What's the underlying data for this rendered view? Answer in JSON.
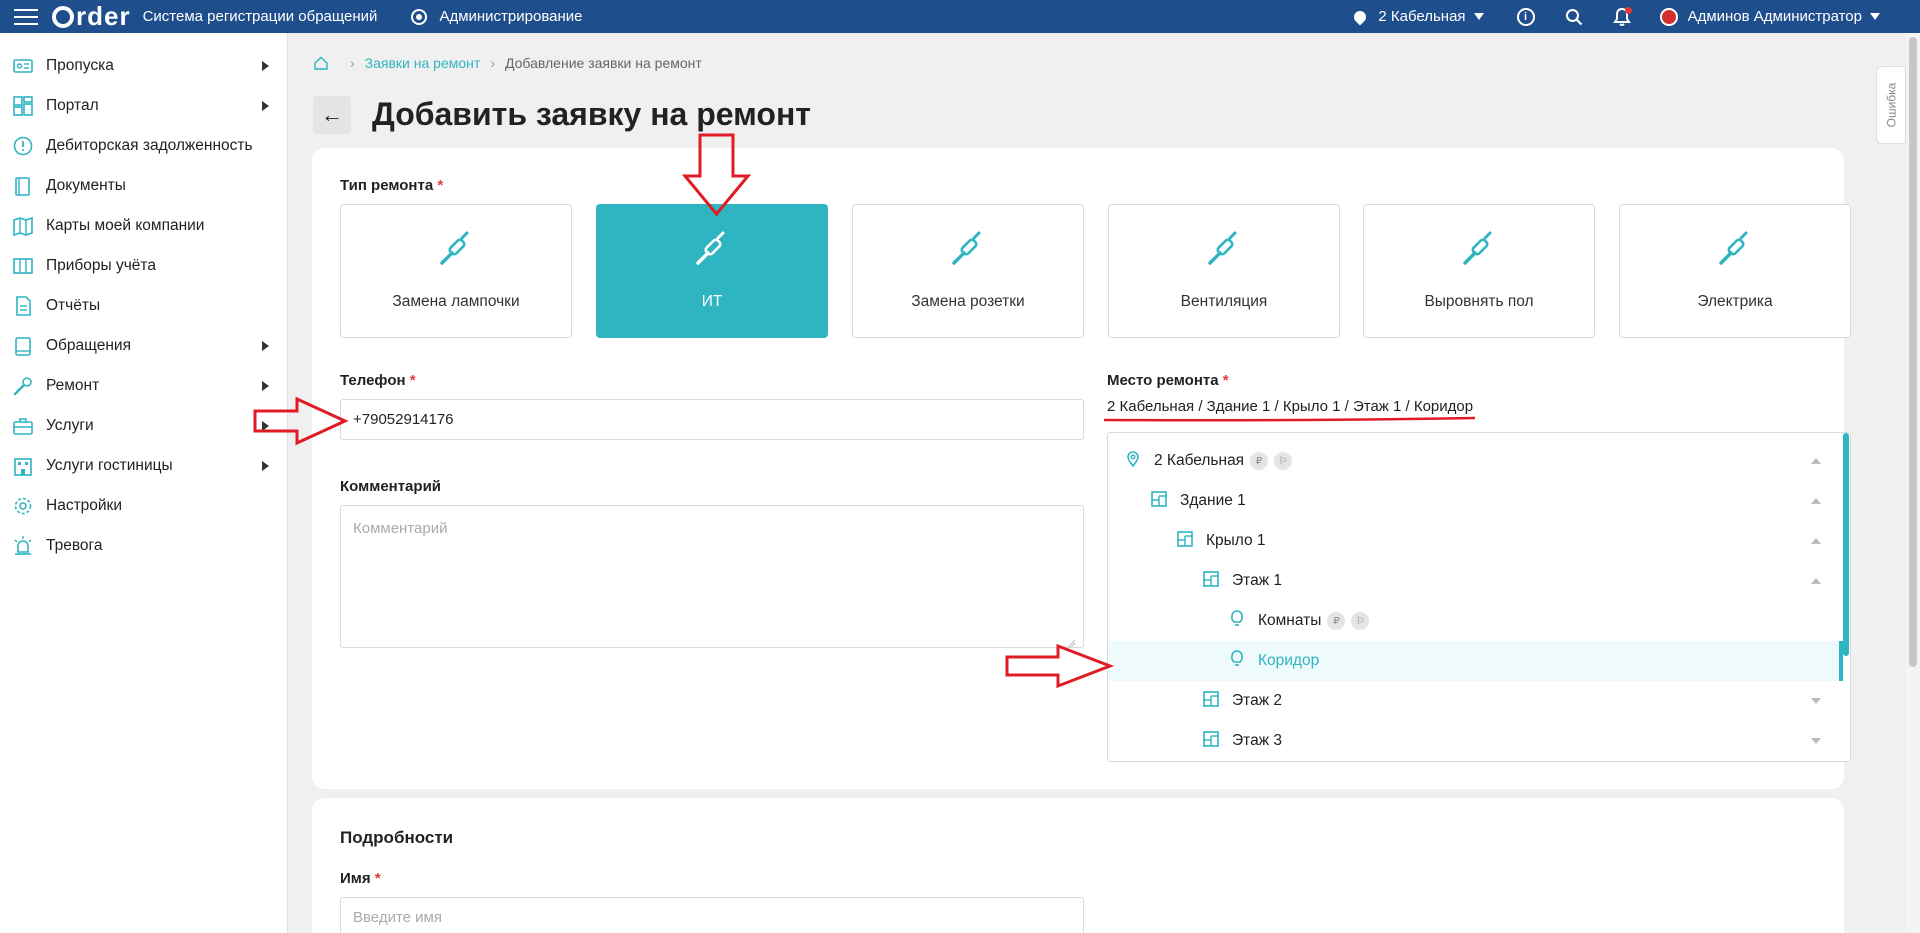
{
  "topbar": {
    "logo": "order",
    "app_title": "Система регистрации обращений",
    "admin_link": "Администрирование",
    "location": "2 Кабельная",
    "user_name": "Админов Администратор"
  },
  "sidebar": {
    "items": [
      {
        "label": "Пропуска",
        "icon": "pass-icon",
        "has_arrow": true
      },
      {
        "label": "Портал",
        "icon": "grid-icon",
        "has_arrow": true
      },
      {
        "label": "Дебиторская задолженность",
        "icon": "alert-circle-icon",
        "has_arrow": false
      },
      {
        "label": "Документы",
        "icon": "document-icon",
        "has_arrow": false
      },
      {
        "label": "Карты моей компании",
        "icon": "map-icon",
        "has_arrow": false
      },
      {
        "label": "Приборы учёта",
        "icon": "meter-icon",
        "has_arrow": false
      },
      {
        "label": "Отчёты",
        "icon": "report-icon",
        "has_arrow": false
      },
      {
        "label": "Обращения",
        "icon": "book-icon",
        "has_arrow": true
      },
      {
        "label": "Ремонт",
        "icon": "wrench-icon",
        "has_arrow": true
      },
      {
        "label": "Услуги",
        "icon": "briefcase-icon",
        "has_arrow": true
      },
      {
        "label": "Услуги гостиницы",
        "icon": "hotel-icon",
        "has_arrow": true
      },
      {
        "label": "Настройки",
        "icon": "gear-icon",
        "has_arrow": false
      },
      {
        "label": "Тревога",
        "icon": "siren-icon",
        "has_arrow": false
      }
    ]
  },
  "breadcrumb": {
    "link": "Заявки на ремонт",
    "current": "Добавление заявки на ремонт"
  },
  "page_title": "Добавить заявку на ремонт",
  "form": {
    "repair_type_label": "Тип ремонта",
    "required_mark": "*",
    "repair_types": [
      {
        "label": "Замена лампочки",
        "active": false
      },
      {
        "label": "ИТ",
        "active": true
      },
      {
        "label": "Замена розетки",
        "active": false
      },
      {
        "label": "Вентиляция",
        "active": false
      },
      {
        "label": "Выровнять пол",
        "active": false
      },
      {
        "label": "Электрика",
        "active": false
      }
    ],
    "phone_label": "Телефон",
    "phone_value": "+79052914176",
    "comment_label": "Комментарий",
    "comment_placeholder": "Комментарий",
    "place_label": "Место ремонта",
    "place_path": "2 Кабельная / Здание 1 / Крыло 1 / Этаж 1 / Коридор",
    "tree": [
      {
        "label": "2 Кабельная",
        "level": 0,
        "icon": "location-pin-icon",
        "chevron": "up",
        "badges": [
          "₽",
          "⚐"
        ],
        "selected": false
      },
      {
        "label": "Здание 1",
        "level": 1,
        "icon": "building-plan-icon",
        "chevron": "up",
        "badges": [],
        "selected": false
      },
      {
        "label": "Крыло 1",
        "level": 2,
        "icon": "building-plan-icon",
        "chevron": "up",
        "badges": [],
        "selected": false
      },
      {
        "label": "Этаж 1",
        "level": 3,
        "icon": "building-plan-icon",
        "chevron": "up",
        "badges": [],
        "selected": false
      },
      {
        "label": "Комнаты",
        "level": 4,
        "icon": "lightbulb-icon",
        "chevron": "",
        "badges": [
          "₽",
          "⚐"
        ],
        "selected": false
      },
      {
        "label": "Коридор",
        "level": 4,
        "icon": "lightbulb-icon",
        "chevron": "",
        "badges": [],
        "selected": true
      },
      {
        "label": "Этаж 2",
        "level": 3,
        "icon": "building-plan-icon",
        "chevron": "down",
        "badges": [],
        "selected": false
      },
      {
        "label": "Этаж 3",
        "level": 3,
        "icon": "building-plan-icon",
        "chevron": "down",
        "badges": [],
        "selected": false
      }
    ]
  },
  "details": {
    "title": "Подробности",
    "name_label": "Имя",
    "name_placeholder": "Введите имя"
  },
  "error_tab": "Ошибка",
  "colors": {
    "topbar": "#1f4e8c",
    "accent": "#2fb4c2",
    "required": "#e53935",
    "annotation": "#e01b24"
  }
}
